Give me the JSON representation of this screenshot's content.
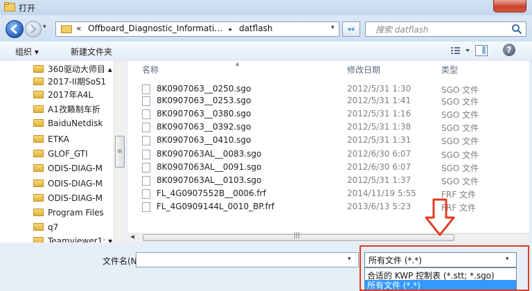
{
  "window": {
    "title": "打开"
  },
  "address": {
    "history_chevron": "«",
    "path": [
      "Offboard_Diagnostic_Informati...",
      "datflash"
    ],
    "separator": "▸",
    "search_placeholder": "搜索 datflash"
  },
  "toolbar": {
    "organize_label": "组织 ▾",
    "new_folder_label": "新建文件夹"
  },
  "navigation": {
    "items": [
      {
        "label": "360驱动大师目 ▴"
      },
      {
        "label": "2017-II期SoS1"
      },
      {
        "label": "2017年A4L"
      },
      {
        "label": "A1孜籁制车折"
      },
      {
        "label": "BaiduNetdisk"
      },
      {
        "label": "ETKA"
      },
      {
        "label": "GLOF_GTI"
      },
      {
        "label": "ODIS-DIAG-M"
      },
      {
        "label": "ODIS-DIAG-M"
      },
      {
        "label": "ODIS-DIAG-M"
      },
      {
        "label": "Program Files"
      },
      {
        "label": "q7"
      },
      {
        "label": "Teamviewer1: ▾"
      }
    ]
  },
  "file_list": {
    "columns": {
      "name": "名称",
      "date": "修改日期",
      "type": "类型"
    },
    "rows": [
      {
        "name": "8K0907063__0250.sgo",
        "date": "2012/5/31 1:30",
        "type": "SGO 文件"
      },
      {
        "name": "8K0907063__0253.sgo",
        "date": "2012/5/31 1:41",
        "type": "SGO 文件"
      },
      {
        "name": "8K0907063__0380.sgo",
        "date": "2012/5/31 1:16",
        "type": "SGO 文件"
      },
      {
        "name": "8K0907063__0392.sgo",
        "date": "2012/5/31 1:38",
        "type": "SGO 文件"
      },
      {
        "name": "8K0907063__0410.sgo",
        "date": "2012/5/31 1:31",
        "type": "SGO 文件"
      },
      {
        "name": "8K0907063AL__0083.sgo",
        "date": "2012/6/30 6:07",
        "type": "SGO 文件"
      },
      {
        "name": "8K0907063AL__0091.sgo",
        "date": "2012/6/30 6:07",
        "type": "SGO 文件"
      },
      {
        "name": "8K0907063AL__0103.sgo",
        "date": "2012/5/31 1:37",
        "type": "SGO 文件"
      },
      {
        "name": "FL_4G0907552B__0006.frf",
        "date": "2014/11/19 5:55",
        "type": "FRF 文件"
      },
      {
        "name": "FL_4G0909144L_0010_BP.frf",
        "date": "2013/6/13 5:23",
        "type": "FRF 文件"
      }
    ]
  },
  "bottom": {
    "filename_label": "文件名(N):",
    "filename_value": "",
    "filetype_selected": "所有文件 (*.*)",
    "filetype_options": [
      {
        "label": "合适的 KWP 控制表 (*.stt; *.sgo)",
        "highlighted": false
      },
      {
        "label": "所有文件 (*.*)",
        "highlighted": true
      }
    ]
  },
  "colors": {
    "annotation_red": "#e23a23",
    "selection_blue": "#3399ff"
  }
}
